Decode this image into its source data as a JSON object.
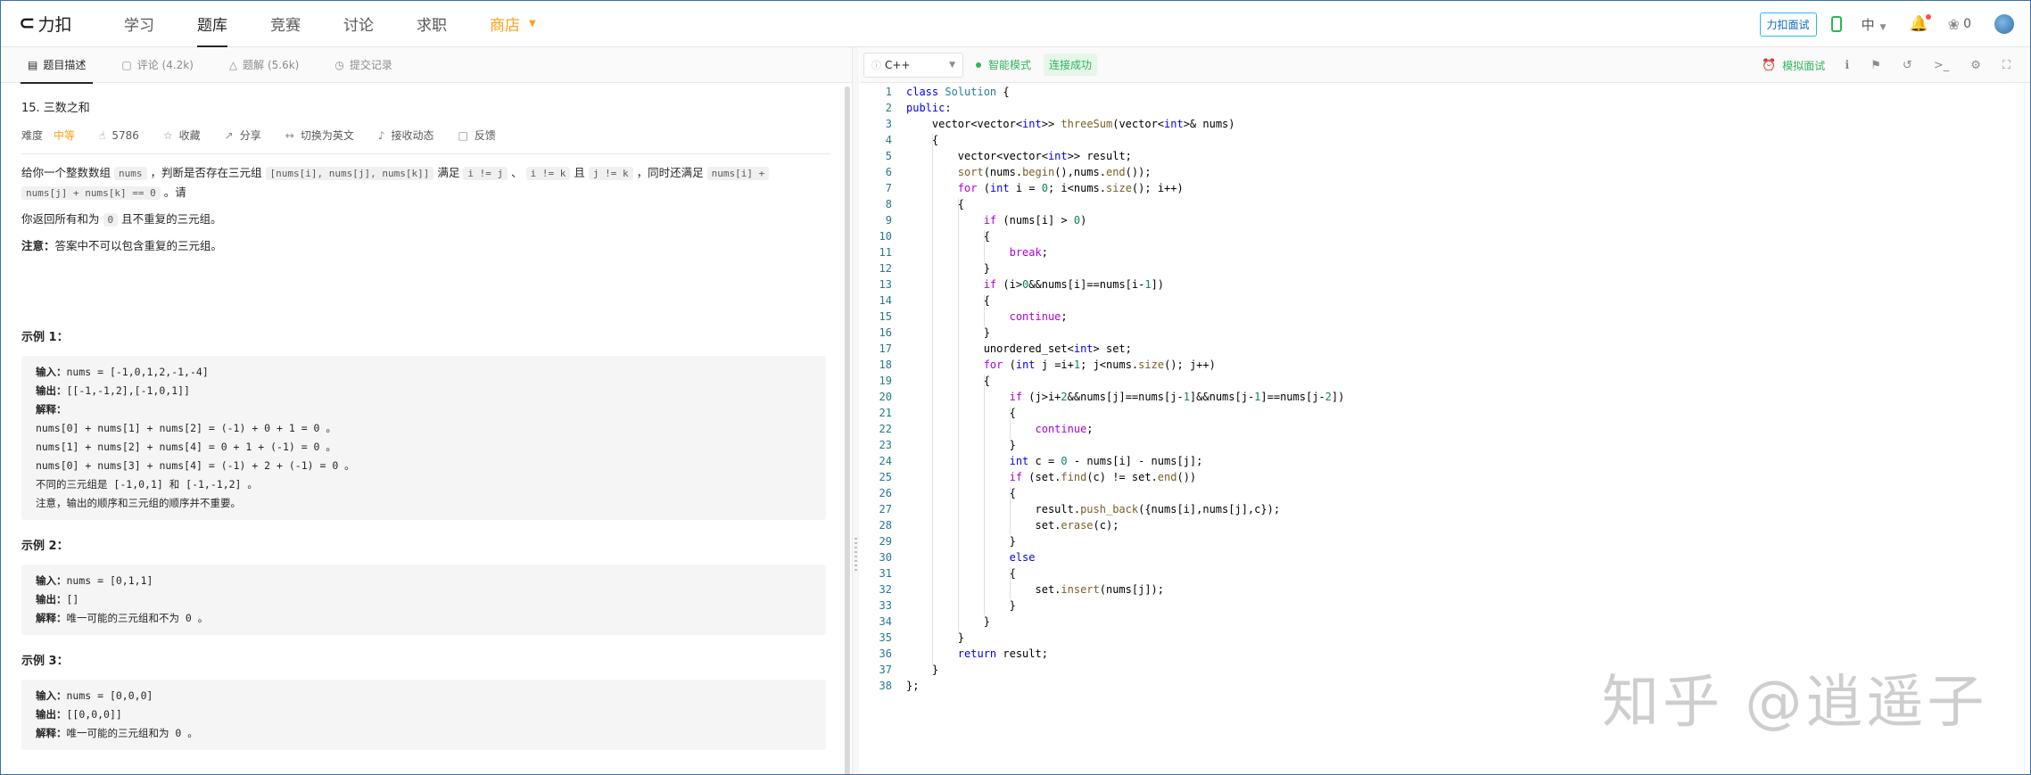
{
  "nav": {
    "logo_text": "力扣",
    "items": [
      {
        "label": "学习"
      },
      {
        "label": "题库"
      },
      {
        "label": "竞赛"
      },
      {
        "label": "讨论"
      },
      {
        "label": "求职"
      },
      {
        "label": "商店"
      }
    ],
    "interview_button": "力扣面试",
    "language": "中",
    "fire_count": "0",
    "icons": {
      "phone": "phone-icon",
      "bell": "bell-icon",
      "fire": "fire-icon",
      "avatar": "avatar"
    }
  },
  "left_tabs": [
    {
      "label": "题目描述",
      "icon": "document-icon"
    },
    {
      "label": "评论 (4.2k)",
      "icon": "comment-icon"
    },
    {
      "label": "题解 (5.6k)",
      "icon": "flask-icon"
    },
    {
      "label": "提交记录",
      "icon": "clock-icon"
    }
  ],
  "problem": {
    "title": "15. 三数之和",
    "difficulty_label": "难度",
    "difficulty": "中等",
    "likes": "5786",
    "collect": "收藏",
    "share": "分享",
    "switch_lang": "切换为英文",
    "subscribe": "接收动态",
    "feedback": "反馈",
    "desc_p1_a": "给你一个整数数组",
    "desc_p1_code1": "nums",
    "desc_p1_b": "，判断是否存在三元组",
    "desc_p1_code2": "[nums[i], nums[j], nums[k]]",
    "desc_p1_c": "满足",
    "desc_p1_code3": "i != j",
    "desc_p1_d": "、",
    "desc_p1_code4": "i != k",
    "desc_p1_e": "且",
    "desc_p1_code5": "j != k",
    "desc_p1_f": "，同时还满足",
    "desc_p1_code6": "nums[i] +",
    "desc_p1_code7": "nums[j] + nums[k] == 0",
    "desc_p1_g": "。请",
    "desc_p2_a": "你返回所有和为",
    "desc_p2_code": "0",
    "desc_p2_b": "且不重复的三元组。",
    "note_label": "注意：",
    "note_text": "答案中不可以包含重复的三元组。"
  },
  "examples": [
    {
      "title": "示例 1：",
      "input_label": "输入：",
      "input": "nums = [-1,0,1,2,-1,-4]",
      "output_label": "输出：",
      "output": "[[-1,-1,2],[-1,0,1]]",
      "explain_label": "解释：",
      "lines": [
        "nums[0] + nums[1] + nums[2] = (-1) + 0 + 1 = 0 。",
        "nums[1] + nums[2] + nums[4] = 0 + 1 + (-1) = 0 。",
        "nums[0] + nums[3] + nums[4] = (-1) + 2 + (-1) = 0 。",
        "不同的三元组是 [-1,0,1] 和 [-1,-1,2] 。",
        "注意，输出的顺序和三元组的顺序并不重要。"
      ]
    },
    {
      "title": "示例 2：",
      "input_label": "输入：",
      "input": "nums = [0,1,1]",
      "output_label": "输出：",
      "output": "[]",
      "explain_label": "解释：",
      "explain": "唯一可能的三元组和不为 0 。"
    },
    {
      "title": "示例 3：",
      "input_label": "输入：",
      "input": "nums = [0,0,0]",
      "output_label": "输出：",
      "output": "[[0,0,0]]",
      "explain_label": "解释：",
      "explain": "唯一可能的三元组和为 0 。"
    }
  ],
  "editor_toolbar": {
    "language": "C++",
    "smart_mode": "智能模式",
    "connection": "连接成功",
    "mock_interview": "模拟面试"
  },
  "code_lines": [
    "class Solution {",
    "public:",
    "    vector<vector<int>> threeSum(vector<int>& nums)",
    "    {",
    "        vector<vector<int>> result;",
    "        sort(nums.begin(),nums.end());",
    "        for (int i = 0; i<nums.size(); i++)",
    "        {",
    "            if (nums[i] > 0)",
    "            {",
    "                break;",
    "            }",
    "            if (i>0&&nums[i]==nums[i-1])",
    "            {",
    "                continue;",
    "            }",
    "            unordered_set<int> set;",
    "            for (int j =i+1; j<nums.size(); j++)",
    "            {",
    "                if (j>i+2&&nums[j]==nums[j-1]&&nums[j-1]==nums[j-2])",
    "                {",
    "                    continue;",
    "                }",
    "                int c = 0 - nums[i] - nums[j];",
    "                if (set.find(c) != set.end())",
    "                {",
    "                    result.push_back({nums[i],nums[j],c});",
    "                    set.erase(c);",
    "                }",
    "                else",
    "                {",
    "                    set.insert(nums[j]);",
    "                }",
    "            }",
    "        }",
    "        return result;",
    "    }",
    "};"
  ],
  "watermark": "知乎 @逍遥子"
}
